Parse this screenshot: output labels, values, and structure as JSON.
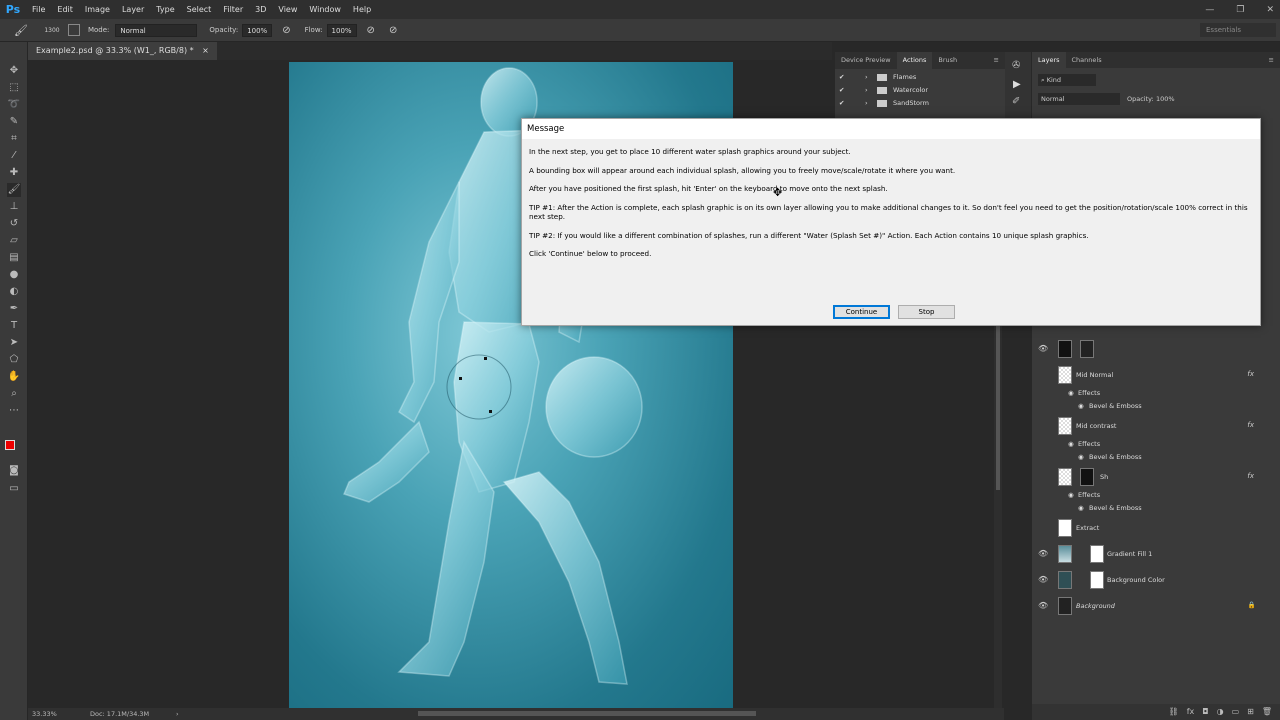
{
  "app": {
    "logo": "Ps",
    "menus": [
      "File",
      "Edit",
      "Image",
      "Layer",
      "Type",
      "Select",
      "Filter",
      "3D",
      "View",
      "Window",
      "Help"
    ],
    "window_controls": [
      "—",
      "❐",
      "✕"
    ]
  },
  "options": {
    "brush_size": "1300",
    "mode_label": "Mode:",
    "mode_value": "Normal",
    "opacity_label": "Opacity:",
    "opacity_value": "100%",
    "flow_label": "Flow:",
    "flow_value": "100%",
    "workspace": "Essentials"
  },
  "document": {
    "tab": "Example2.psd @ 33.3% (W1_, RGB/8) *",
    "tab_close": "×"
  },
  "status": {
    "zoom": "33.33%",
    "doc": "Doc: 17.1M/34.3M",
    "arrow": "›"
  },
  "actions_panel": {
    "tabs": [
      "Device Preview",
      "Actions",
      "Brush"
    ],
    "items": [
      "Flames",
      "Watercolor",
      "SandStorm"
    ]
  },
  "layers_panel": {
    "tabs": [
      "Layers",
      "Channels"
    ],
    "kind": "Kind",
    "blend": "Normal",
    "opacity_label": "Opacity:",
    "opacity_value": "100%",
    "layers": [
      {
        "name": ""
      },
      {
        "name": "Mid Normal",
        "fx": "fx",
        "effects": "Effects",
        "effect": "Bevel & Emboss"
      },
      {
        "name": "Mid contrast",
        "fx": "fx",
        "effects": "Effects",
        "effect": "Bevel & Emboss"
      },
      {
        "name": "Sh",
        "fx": "fx",
        "effects": "Effects",
        "effect": "Bevel & Emboss"
      },
      {
        "name": "Extract"
      },
      {
        "name": "Gradient Fill 1"
      },
      {
        "name": "Background Color"
      },
      {
        "name": "Background"
      }
    ]
  },
  "dialog": {
    "title": "Message",
    "lines": [
      "In the next step, you get to place 10 different water splash graphics around your subject.",
      "A bounding box will appear around each individual splash, allowing you to freely move/scale/rotate it where you want.",
      "After you have positioned the first splash, hit 'Enter' on the keyboard to move onto the next splash.",
      "TIP #1: After the Action is complete, each splash graphic is on its own layer allowing you to make additional changes to it. So don't feel you need to get the position/rotation/scale 100% correct in this next step.",
      "TIP #2: If you would like a different combination of splashes, run a different \"Water (Splash Set #)\" Action. Each Action contains 10 unique splash graphics.",
      "Click 'Continue' below to proceed."
    ],
    "continue_label": "Continue",
    "stop_label": "Stop"
  }
}
